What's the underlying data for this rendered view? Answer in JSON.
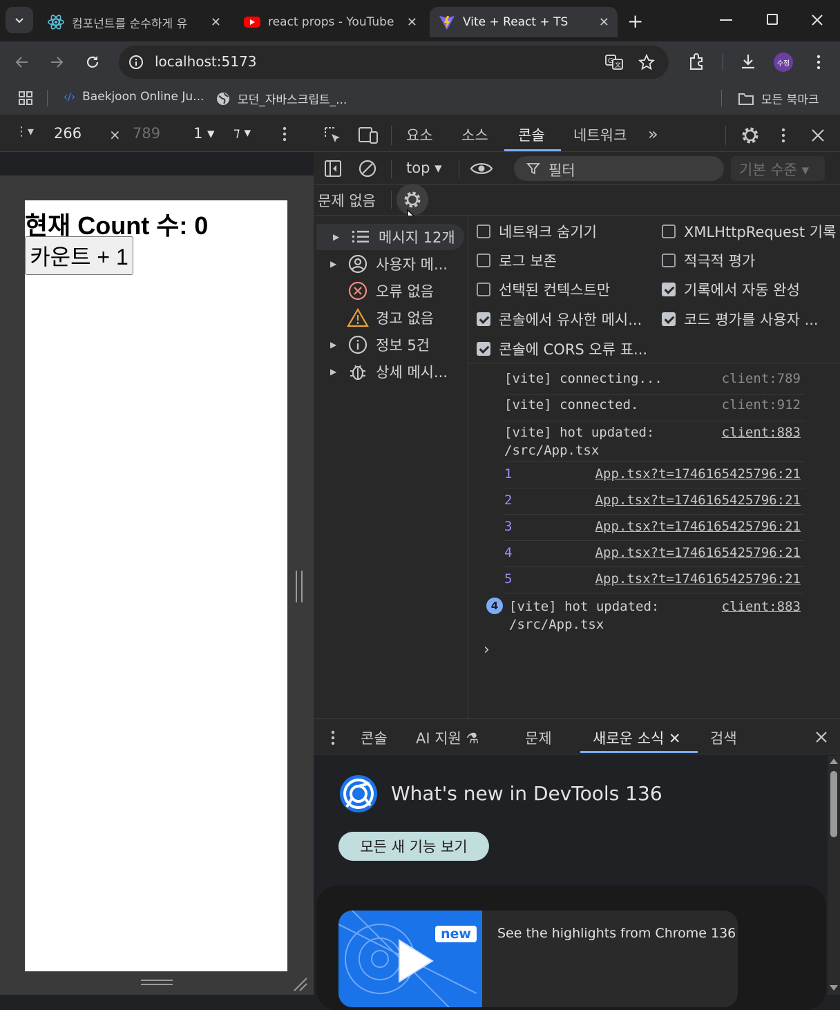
{
  "tabs": [
    {
      "title": "컴포넌트를 순수하게 유",
      "close": "✕"
    },
    {
      "title": "react props - YouTube",
      "close": "✕"
    },
    {
      "title": "Vite + React + TS",
      "close": "✕"
    }
  ],
  "new_tab": "+",
  "address": {
    "url": "localhost:5173"
  },
  "profile": {
    "label": "수정"
  },
  "bookmarks": [
    {
      "label": "Baekjoon Online Ju..."
    },
    {
      "label": "모던_자바스크립트_..."
    }
  ],
  "all_bookmarks": "모든 북마크",
  "device_toolbar": {
    "width": "266",
    "height": "789",
    "zoom": "1",
    "times": "×"
  },
  "page": {
    "heading": "현재 Count 수: 0",
    "button": "카운트 + 1"
  },
  "devtools": {
    "tabs": [
      "요소",
      "소스",
      "콘솔",
      "네트워크"
    ],
    "active_tab": "콘솔",
    "context": "top",
    "filter_placeholder": "필터",
    "level": "기본 수준",
    "issues": "문제 없음"
  },
  "sidebar": [
    {
      "label": "메시지 12개",
      "icon": "list-icon",
      "caret": true
    },
    {
      "label": "사용자 메...",
      "icon": "user-icon",
      "caret": true
    },
    {
      "label": "오류 없음",
      "icon": "error-icon",
      "caret": false
    },
    {
      "label": "경고 없음",
      "icon": "warning-icon",
      "caret": false
    },
    {
      "label": "정보 5건",
      "icon": "info-icon",
      "caret": true
    },
    {
      "label": "상세 메시...",
      "icon": "bug-icon",
      "caret": true
    }
  ],
  "settings": [
    {
      "label": "네트워크 숨기기",
      "checked": false
    },
    {
      "label": "XMLHttpRequest 기록",
      "checked": false
    },
    {
      "label": "로그 보존",
      "checked": false
    },
    {
      "label": "적극적 평가",
      "checked": false
    },
    {
      "label": "선택된 컨텍스트만",
      "checked": false
    },
    {
      "label": "기록에서 자동 완성",
      "checked": true
    },
    {
      "label": "콘솔에서 유사한 메시...",
      "checked": true
    },
    {
      "label": "코드 평가를 사용자 ...",
      "checked": true
    },
    {
      "label": "콘솔에 CORS 오류 표...",
      "checked": true
    }
  ],
  "console": [
    {
      "text": "[vite] connecting...",
      "source": "client:789"
    },
    {
      "text": "[vite] connected.",
      "source": "client:912"
    },
    {
      "text": "[vite] hot updated:",
      "text2": "/src/App.tsx",
      "source": "client:883"
    },
    {
      "text": "1",
      "source": "App.tsx?t=1746165425796:21"
    },
    {
      "text": "2",
      "source": "App.tsx?t=1746165425796:21"
    },
    {
      "text": "3",
      "source": "App.tsx?t=1746165425796:21"
    },
    {
      "text": "4",
      "source": "App.tsx?t=1746165425796:21"
    },
    {
      "text": "5",
      "source": "App.tsx?t=1746165425796:21"
    },
    {
      "text": "[vite] hot updated:",
      "text2": "/src/App.tsx",
      "source": "client:883",
      "badge": "4"
    }
  ],
  "prompt": "›",
  "drawer": {
    "tabs": [
      "콘솔",
      "AI 지원 ⚗",
      "문제",
      "새로운 소식",
      "검색"
    ],
    "active": "새로운 소식",
    "title": "What's new in DevTools 136",
    "button": "모든 새 기능 보기",
    "promo_badge": "new",
    "promo_text": "See the highlights from Chrome 136"
  },
  "colors": {
    "accent": "#7cacf8",
    "error": "#f28b82",
    "warning": "#fdd663",
    "chrome_blue": "#1a73e8"
  }
}
